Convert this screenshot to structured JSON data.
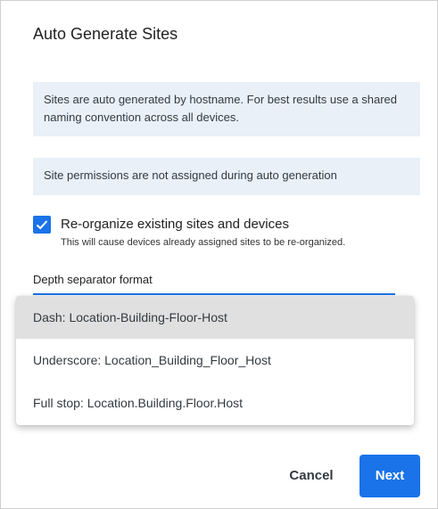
{
  "dialog": {
    "title": "Auto Generate Sites",
    "info_hostname": "Sites are auto generated by hostname. For best results use a shared naming convention across all devices.",
    "info_permissions": "Site permissions are not assigned during auto generation",
    "reorganize": {
      "checked": true,
      "label": "Re-organize existing sites and devices",
      "description": "This will cause devices already assigned sites to be re-organized."
    },
    "separator": {
      "label": "Depth separator format",
      "options": [
        "Dash: Location-Building-Floor-Host",
        "Underscore: Location_Building_Floor_Host",
        "Full stop: Location.Building.Floor.Host"
      ],
      "highlighted": "Dash: Location-Building-Floor-Host"
    },
    "buttons": {
      "cancel": "Cancel",
      "next": "Next"
    }
  },
  "colors": {
    "accent": "#1a73e8",
    "info_background": "#e9f0f8",
    "option_highlight": "#e0e0e0"
  },
  "icons": {
    "checkbox": "check-icon"
  }
}
